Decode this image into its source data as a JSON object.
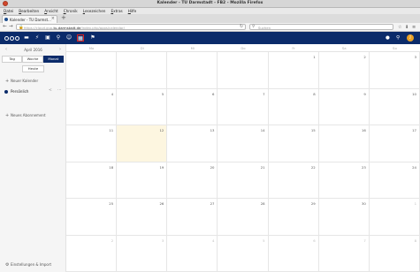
{
  "window": {
    "title": "Kalender - TU Darmstadt - FB2 - Mozilla Firefox"
  },
  "menu": [
    "Datei",
    "Bearbeiten",
    "Ansicht",
    "Chronik",
    "Lesezeichen",
    "Extras",
    "Hilfe"
  ],
  "tab": {
    "label": "Kalender - TU Darmst...",
    "close": "×",
    "new": "+"
  },
  "url": {
    "prefix": "https://cloud.gup",
    "domain": ".tu-darmstadt.de",
    "path": "/index.php/apps/calendar/"
  },
  "search": {
    "placeholder": "Suchen"
  },
  "sidebar": {
    "month_label": "April 2016",
    "prev": "‹",
    "next": "›",
    "views": [
      "Tag",
      "Woche",
      "Monat"
    ],
    "today": "Heute",
    "new_calendar": "Neuer Kalender",
    "calendar_name": "Persönlich",
    "new_subscription": "Neues Abonnement",
    "settings": "Einstellungen & Import"
  },
  "calendar": {
    "weekdays": [
      "Mo",
      "Di",
      "Mi",
      "Do",
      "Fr",
      "Sa",
      "So"
    ],
    "weeks": [
      [
        "",
        "",
        "",
        "",
        "1",
        "2",
        "3"
      ],
      [
        "4",
        "5",
        "6",
        "7",
        "8",
        "9",
        "10"
      ],
      [
        "11",
        "12",
        "13",
        "14",
        "15",
        "16",
        "17"
      ],
      [
        "18",
        "19",
        "20",
        "21",
        "22",
        "23",
        "24"
      ],
      [
        "25",
        "26",
        "27",
        "28",
        "29",
        "30",
        "1"
      ],
      [
        "2",
        "3",
        "4",
        "5",
        "6",
        "7",
        "8"
      ]
    ],
    "today": {
      "week": 2,
      "day": 1
    },
    "accent": "#0b2b6a",
    "today_color": "#fdf6e0"
  }
}
